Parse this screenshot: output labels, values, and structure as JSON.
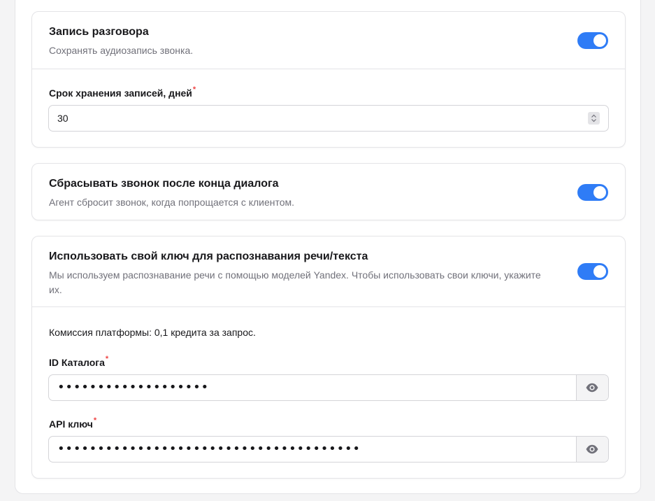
{
  "recording": {
    "title": "Запись разговора",
    "description": "Сохранять аудиозапись звонка.",
    "enabled": true,
    "retention_label": "Срок хранения записей, дней",
    "retention_required": "*",
    "retention_value": "30"
  },
  "hangup": {
    "title": "Сбрасывать звонок после конца диалога",
    "description": "Агент сбросит звонок, когда попрощается с клиентом.",
    "enabled": true
  },
  "custom_key": {
    "title": "Использовать свой ключ для распознавания речи/текста",
    "description": "Мы используем распознавание речи с помощью моделей Yandex. Чтобы использовать свои ключи, укажите их.",
    "enabled": true,
    "commission_text": "Комиссия платформы: 0,1 кредита за запрос.",
    "catalog_label": "ID Каталога",
    "catalog_required": "*",
    "catalog_value": "•••••••••••••••••••",
    "api_label": "API ключ",
    "api_required": "*",
    "api_value": "••••••••••••••••••••••••••••••••••••••"
  },
  "colors": {
    "accent": "#2f7cf6",
    "required": "#ef4444",
    "muted_text": "#71717a"
  },
  "icons": {
    "stepper": "up-down-stepper-icon",
    "reveal": "eye-icon"
  }
}
